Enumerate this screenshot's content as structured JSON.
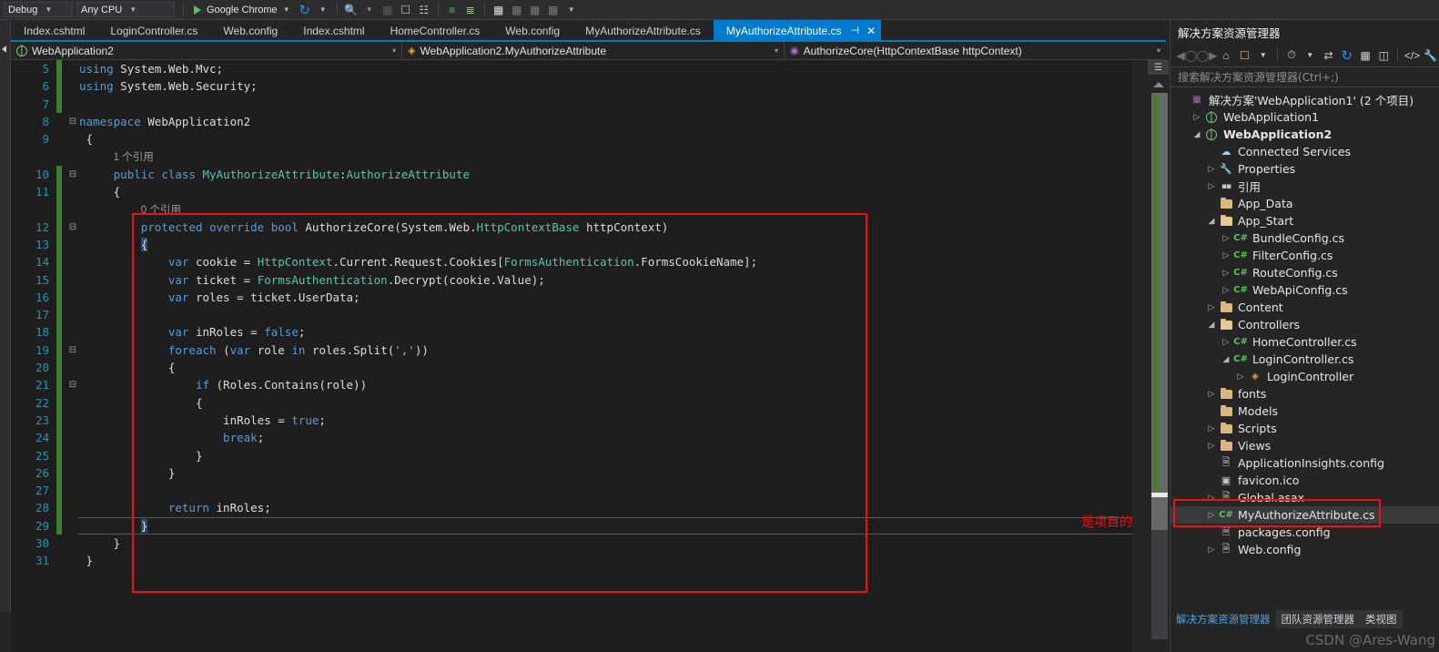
{
  "toolbar": {
    "config_combo": "Debug",
    "platform_combo": "Any CPU",
    "run_label": "Google Chrome",
    "icons": [
      "play-icon",
      "refresh-icon",
      "step-icon",
      "breakpoint-icon",
      "comment-icon",
      "uncomment-icon",
      "indent-icon",
      "outdent-icon",
      "bookmark-icon",
      "prev-bookmark-icon",
      "next-bookmark-icon",
      "clear-bookmark-icon"
    ]
  },
  "tabs": [
    {
      "label": "Index.cshtml",
      "active": false
    },
    {
      "label": "LoginController.cs",
      "active": false
    },
    {
      "label": "Web.config",
      "active": false
    },
    {
      "label": "Index.cshtml",
      "active": false
    },
    {
      "label": "HomeController.cs",
      "active": false
    },
    {
      "label": "Web.config",
      "active": false
    },
    {
      "label": "MyAuthorizeAttribute.cs",
      "active": false
    },
    {
      "label": "MyAuthorizeAttribute.cs",
      "active": true,
      "pin": "⊣",
      "close": "✕"
    }
  ],
  "tabstrip_controls": {
    "overflow": "«",
    "dropdown": "▼"
  },
  "navbar": {
    "project": "WebApplication2",
    "type": "WebApplication2.MyAuthorizeAttribute",
    "member": "AuthorizeCore(HttpContextBase httpContext)",
    "dropdown_arrow": "▾"
  },
  "editor": {
    "lines": [
      {
        "num": "5",
        "changed": true,
        "fold": "",
        "html": "<span class=\"k\">using</span> <span class=\"p\">System.Web.Mvc;</span>",
        "indent_guides": []
      },
      {
        "num": "6",
        "changed": true,
        "fold": "",
        "html": "<span class=\"k\">using</span> <span class=\"p\">System.Web.Security;</span>",
        "indent_guides": []
      },
      {
        "num": "7",
        "changed": true,
        "fold": "",
        "html": "",
        "indent_guides": []
      },
      {
        "num": "8",
        "changed": false,
        "fold": "⊟",
        "html": "<span class=\"k\">namespace</span> <span class=\"p\">WebApplication2</span>",
        "indent_guides": []
      },
      {
        "num": "9",
        "changed": false,
        "fold": "",
        "html": " <span class=\"br\">{</span>",
        "indent_guides": []
      },
      {
        "num": "",
        "changed": false,
        "fold": "",
        "html": "     <span class=\"ref\">1 个引用</span>",
        "indent_guides": []
      },
      {
        "num": "10",
        "changed": true,
        "fold": "⊟",
        "html": "     <span class=\"k\">public</span> <span class=\"k\">class</span> <span class=\"t\">MyAuthorizeAttribute</span><span class=\"p\">:</span><span class=\"t\">AuthorizeAttribute</span>",
        "indent_guides": []
      },
      {
        "num": "11",
        "changed": true,
        "fold": "",
        "html": "     <span class=\"br\">{</span>",
        "indent_guides": []
      },
      {
        "num": "",
        "changed": true,
        "fold": "",
        "html": "         <span class=\"ref\">0 个引用</span>",
        "indent_guides": []
      },
      {
        "num": "12",
        "changed": true,
        "fold": "⊟",
        "html": "         <span class=\"k\">protected</span> <span class=\"k\">override</span> <span class=\"k\">bool</span> <span class=\"p\">AuthorizeCore(System.Web.</span><span class=\"t\">HttpContextBase</span> <span class=\"p\">httpContext)</span>",
        "indent_guides": []
      },
      {
        "num": "13",
        "changed": true,
        "fold": "",
        "html": "         <span class=\"hl-sel\">{</span>",
        "indent_guides": []
      },
      {
        "num": "14",
        "changed": true,
        "fold": "",
        "html": "             <span class=\"k\">var</span> <span class=\"p\">cookie = </span><span class=\"t\">HttpContext</span><span class=\"p\">.Current.Request.Cookies[</span><span class=\"t\">FormsAuthentication</span><span class=\"p\">.FormsCookieName];</span>",
        "indent_guides": []
      },
      {
        "num": "15",
        "changed": true,
        "fold": "",
        "html": "             <span class=\"k\">var</span> <span class=\"p\">ticket = </span><span class=\"t\">FormsAuthentication</span><span class=\"p\">.Decrypt(cookie.Value);</span>",
        "indent_guides": []
      },
      {
        "num": "16",
        "changed": true,
        "fold": "",
        "html": "             <span class=\"k\">var</span> <span class=\"p\">roles = ticket.UserData;</span>",
        "indent_guides": []
      },
      {
        "num": "17",
        "changed": true,
        "fold": "",
        "html": "",
        "indent_guides": []
      },
      {
        "num": "18",
        "changed": true,
        "fold": "",
        "html": "             <span class=\"k\">var</span> <span class=\"p\">inRoles = </span><span class=\"k\">false</span><span class=\"p\">;</span>",
        "indent_guides": []
      },
      {
        "num": "19",
        "changed": true,
        "fold": "⊟",
        "html": "             <span class=\"k\">foreach</span> <span class=\"p\">(</span><span class=\"k\">var</span> <span class=\"p\">role </span><span class=\"k\">in</span> <span class=\"p\">roles.Split(</span><span class=\"s\">','</span><span class=\"p\">))</span>",
        "indent_guides": []
      },
      {
        "num": "20",
        "changed": true,
        "fold": "",
        "html": "             <span class=\"br\">{</span>",
        "indent_guides": []
      },
      {
        "num": "21",
        "changed": true,
        "fold": "⊟",
        "html": "                 <span class=\"k\">if</span> <span class=\"p\">(Roles.Contains(role))</span>",
        "indent_guides": []
      },
      {
        "num": "22",
        "changed": true,
        "fold": "",
        "html": "                 <span class=\"br\">{</span>",
        "indent_guides": []
      },
      {
        "num": "23",
        "changed": true,
        "fold": "",
        "html": "                     <span class=\"p\">inRoles = </span><span class=\"k\">true</span><span class=\"p\">;</span>",
        "indent_guides": []
      },
      {
        "num": "24",
        "changed": true,
        "fold": "",
        "html": "                     <span class=\"k\">break</span><span class=\"p\">;</span>",
        "indent_guides": []
      },
      {
        "num": "25",
        "changed": true,
        "fold": "",
        "html": "                 <span class=\"br\">}</span>",
        "indent_guides": []
      },
      {
        "num": "26",
        "changed": true,
        "fold": "",
        "html": "             <span class=\"br\">}</span>",
        "indent_guides": []
      },
      {
        "num": "27",
        "changed": true,
        "fold": "",
        "html": "",
        "indent_guides": []
      },
      {
        "num": "28",
        "changed": true,
        "fold": "",
        "html": "             <span class=\"k\">return</span> <span class=\"p\">inRoles;</span>",
        "indent_guides": []
      },
      {
        "num": "29",
        "changed": true,
        "fold": "",
        "html": "         <span class=\"hl-sel\">}</span>",
        "indent_guides": [],
        "current": true
      },
      {
        "num": "30",
        "changed": false,
        "fold": "",
        "html": "     <span class=\"br\">}</span>",
        "indent_guides": []
      },
      {
        "num": "31",
        "changed": false,
        "fold": "",
        "html": " <span class=\"br\">}</span>",
        "indent_guides": []
      }
    ],
    "annotation_text": "是项目的根目录",
    "annotation_color": "#ee1111"
  },
  "solution_explorer": {
    "title": "解决方案资源管理器",
    "search_placeholder": "搜索解决方案资源管理器(Ctrl+;)",
    "toolbar_icons": [
      "back-icon",
      "forward-icon",
      "home-icon",
      "sync-with-active-document-icon",
      "dropdown-icon",
      "pending-changes-icon",
      "collapse-dropdown-icon",
      "show-all-files-icon",
      "refresh-icon",
      "collapse-all-icon",
      "properties-icon",
      "view-code-icon",
      "properties-wrench-icon"
    ],
    "tree": [
      {
        "depth": 0,
        "twist": "",
        "icon": "solution-icon",
        "label": "解决方案'WebApplication1' (2 个项目)",
        "bold": false
      },
      {
        "depth": 1,
        "twist": "▷",
        "icon": "project-icon",
        "label": "WebApplication1",
        "bold": false
      },
      {
        "depth": 1,
        "twist": "◢",
        "icon": "project-icon",
        "label": "WebApplication2",
        "bold": true
      },
      {
        "depth": 2,
        "twist": "",
        "icon": "cloud-icon",
        "label": "Connected Services",
        "bold": false
      },
      {
        "depth": 2,
        "twist": "▷",
        "icon": "wrench-icon",
        "label": "Properties",
        "bold": false
      },
      {
        "depth": 2,
        "twist": "▷",
        "icon": "references-icon",
        "label": "引用",
        "bold": false
      },
      {
        "depth": 2,
        "twist": "",
        "icon": "folder-icon",
        "label": "App_Data",
        "bold": false
      },
      {
        "depth": 2,
        "twist": "◢",
        "icon": "folder-open-icon",
        "label": "App_Start",
        "bold": false
      },
      {
        "depth": 3,
        "twist": "▷",
        "icon": "csharp-icon",
        "label": "BundleConfig.cs",
        "bold": false
      },
      {
        "depth": 3,
        "twist": "▷",
        "icon": "csharp-icon",
        "label": "FilterConfig.cs",
        "bold": false
      },
      {
        "depth": 3,
        "twist": "▷",
        "icon": "csharp-icon",
        "label": "RouteConfig.cs",
        "bold": false
      },
      {
        "depth": 3,
        "twist": "▷",
        "icon": "csharp-icon",
        "label": "WebApiConfig.cs",
        "bold": false
      },
      {
        "depth": 2,
        "twist": "▷",
        "icon": "folder-icon",
        "label": "Content",
        "bold": false
      },
      {
        "depth": 2,
        "twist": "◢",
        "icon": "folder-open-icon",
        "label": "Controllers",
        "bold": false
      },
      {
        "depth": 3,
        "twist": "▷",
        "icon": "csharp-icon",
        "label": "HomeController.cs",
        "bold": false
      },
      {
        "depth": 3,
        "twist": "◢",
        "icon": "csharp-icon",
        "label": "LoginController.cs",
        "bold": false
      },
      {
        "depth": 4,
        "twist": "▷",
        "icon": "class-icon",
        "label": "LoginController",
        "bold": false
      },
      {
        "depth": 2,
        "twist": "▷",
        "icon": "folder-icon",
        "label": "fonts",
        "bold": false
      },
      {
        "depth": 2,
        "twist": "",
        "icon": "folder-icon",
        "label": "Models",
        "bold": false
      },
      {
        "depth": 2,
        "twist": "▷",
        "icon": "folder-icon",
        "label": "Scripts",
        "bold": false
      },
      {
        "depth": 2,
        "twist": "▷",
        "icon": "folder-icon",
        "label": "Views",
        "bold": false
      },
      {
        "depth": 2,
        "twist": "",
        "icon": "config-icon",
        "label": "ApplicationInsights.config",
        "bold": false
      },
      {
        "depth": 2,
        "twist": "",
        "icon": "image-icon",
        "label": "favicon.ico",
        "bold": false
      },
      {
        "depth": 2,
        "twist": "▷",
        "icon": "asax-icon",
        "label": "Global.asax",
        "bold": false
      },
      {
        "depth": 2,
        "twist": "▷",
        "icon": "csharp-icon",
        "label": "MyAuthorizeAttribute.cs",
        "bold": false,
        "selected": true
      },
      {
        "depth": 2,
        "twist": "",
        "icon": "config-icon",
        "label": "packages.config",
        "bold": false
      },
      {
        "depth": 2,
        "twist": "▷",
        "icon": "config-icon",
        "label": "Web.config",
        "bold": false
      }
    ],
    "bottom_tabs": [
      {
        "label": "解决方案资源管理器",
        "active": true
      },
      {
        "label": "团队资源管理器",
        "active": false
      },
      {
        "label": "类视图",
        "active": false
      }
    ]
  },
  "watermark": "CSDN @Ares-Wang"
}
